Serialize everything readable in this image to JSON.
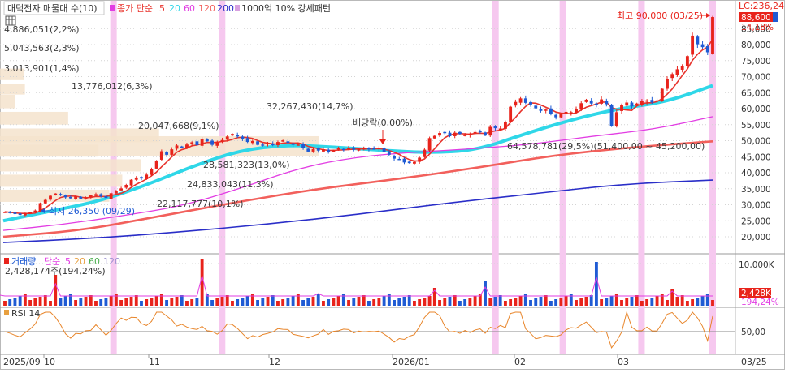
{
  "header": {
    "title": "대덕전자 매물대 수(10)",
    "legend_prefix": "종가 단순",
    "ma": [
      {
        "label": "5",
        "color": "#e8332c"
      },
      {
        "label": "20",
        "color": "#2fd7e8"
      },
      {
        "label": "60",
        "color": "#e23de3"
      },
      {
        "label": "120",
        "color": "#f2605c"
      },
      {
        "label": "200",
        "color": "#2a2ec8"
      }
    ],
    "pattern_label": "1000억 10% 강세패턴"
  },
  "volume_profile": [
    {
      "label": "4,886,051(2,2%)",
      "price_hi": 72500,
      "price_lo": 68900,
      "value": 2.2
    },
    {
      "label": "5,043,563(2,3%)",
      "price_hi": 67600,
      "price_lo": 64400,
      "value": 2.3
    },
    {
      "label": "3,013,901(1,4%)",
      "price_hi": 64300,
      "price_lo": 60100,
      "value": 1.4
    },
    {
      "label": "13,776,012(6,3%)",
      "price_hi": 59000,
      "price_lo": 55000,
      "value": 6.3
    },
    {
      "label": "32,267,430(14,7%)",
      "price_hi": 53800,
      "price_lo": 49500,
      "value": 14.7
    },
    {
      "label": "20,047,668(9,1%)",
      "price_hi": 48800,
      "price_lo": 45000,
      "value": 9.1
    },
    {
      "label": "28,581,323(13,0%)",
      "price_hi": 44200,
      "price_lo": 40400,
      "value": 13.0
    },
    {
      "label": "24,833,043(11,3%)",
      "price_hi": 39400,
      "price_lo": 35600,
      "value": 11.3
    },
    {
      "label": "22,117,777(10,1%)",
      "price_hi": 34700,
      "price_lo": 30900,
      "value": 10.1
    },
    {
      "label": "64,578,781(29,5%)(51,400,00 ~ 45,200,00)",
      "price_hi": 51400,
      "price_lo": 45200,
      "value": 29.5
    }
  ],
  "annotations": {
    "high": "최고 90,000 (03/25)",
    "low": "최저 26,350 (09/29)",
    "dividend": "배당락(0,00%)"
  },
  "price_axis": {
    "lc_label": "LC:236,24",
    "last_price": "88,600",
    "last_change": "14,18%",
    "ticks": [
      "85,000",
      "80,000",
      "75,000",
      "70,000",
      "65,000",
      "60,000",
      "55,000",
      "50,000",
      "45,000",
      "40,000",
      "35,000",
      "30,000",
      "25,000",
      "20,000"
    ]
  },
  "volume_panel": {
    "title": "거래량",
    "legend_prefix": "단순",
    "ma": [
      {
        "label": "5",
        "color": "#e23de3"
      },
      {
        "label": "20",
        "color": "#e8a040"
      },
      {
        "label": "60",
        "color": "#4caf50"
      },
      {
        "label": "120",
        "color": "#9b8fd0"
      }
    ],
    "current": "2,428,174주(194,24%)",
    "tick": "10,000K",
    "last_volume": "2,428K",
    "last_pct": "194,24%"
  },
  "rsi_panel": {
    "title": "RSI 14",
    "tick": "50,00"
  },
  "date_axis": [
    "2025/09",
    "10",
    "11",
    "12",
    "2026/01",
    "02",
    "03",
    "03/25"
  ],
  "colors": {
    "up": "#e8231b",
    "down": "#1f5bd4",
    "highlight": "#f6c8ef",
    "profile": "#f5e3cc"
  },
  "chart_data": {
    "type": "candlestick",
    "x_range": [
      "2025/09/17",
      "2026/03/25"
    ],
    "ylim": [
      17000,
      90000
    ],
    "price_ticks": [
      85000,
      80000,
      75000,
      70000,
      65000,
      60000,
      55000,
      50000,
      45000,
      40000,
      35000,
      30000,
      25000,
      20000
    ],
    "closes": [
      27800,
      27500,
      27100,
      26800,
      27300,
      27600,
      28200,
      30500,
      31500,
      32800,
      33500,
      33000,
      32300,
      32000,
      32600,
      31800,
      32200,
      32900,
      33300,
      32600,
      32100,
      33600,
      34400,
      35100,
      36200,
      37800,
      38500,
      38200,
      39400,
      41200,
      43800,
      46700,
      45600,
      47300,
      48500,
      47900,
      48800,
      49500,
      48600,
      50600,
      49800,
      48700,
      49700,
      50200,
      51300,
      52100,
      51300,
      50600,
      49600,
      49900,
      48700,
      48600,
      49300,
      48600,
      49600,
      50100,
      49300,
      48700,
      48800,
      47700,
      46600,
      47400,
      46900,
      47300,
      46500,
      47000,
      47600,
      47300,
      47700,
      47200,
      47500,
      47600,
      47300,
      47500,
      47800,
      46500,
      45600,
      44400,
      44300,
      43200,
      43000,
      43400,
      44700,
      47200,
      50800,
      51500,
      52400,
      52700,
      51400,
      52500,
      52100,
      51800,
      52200,
      52700,
      52800,
      51600,
      54300,
      53900,
      53800,
      55800,
      60600,
      62100,
      63200,
      61800,
      61300,
      60100,
      59300,
      59700,
      58300,
      57300,
      58400,
      59000,
      58900,
      59800,
      61700,
      62800,
      61600,
      61300,
      62900,
      61400,
      54500,
      58900,
      61200,
      61900,
      60700,
      61600,
      62300,
      62600,
      61900,
      62600,
      66200,
      69300,
      70800,
      72300,
      73200,
      76400,
      82800,
      80100,
      79200,
      77600,
      88600
    ],
    "ma": {
      "5": "follows closes",
      "20": [
        25000,
        28000,
        31000,
        36000,
        42000,
        47000,
        48700,
        48000,
        47000,
        46200,
        47000,
        52000,
        56500,
        60000,
        62000,
        67200
      ],
      "60": [
        22000,
        23800,
        26500,
        29500,
        35000,
        41500,
        45000,
        46500,
        47500,
        49000,
        51500,
        53500,
        57500
      ],
      "120": [
        20000,
        22000,
        26500,
        31000,
        35000,
        38000,
        41500,
        45500,
        48000,
        49800
      ],
      "200": [
        18200,
        19500,
        21500,
        24000,
        27000,
        30500,
        33500,
        36500,
        37700
      ]
    },
    "highlight_bands": [
      "2025/10/16",
      "2025/11/14",
      "2026/01/26",
      "2026/02/13",
      "2026/03/06",
      "2026/03/25"
    ]
  }
}
